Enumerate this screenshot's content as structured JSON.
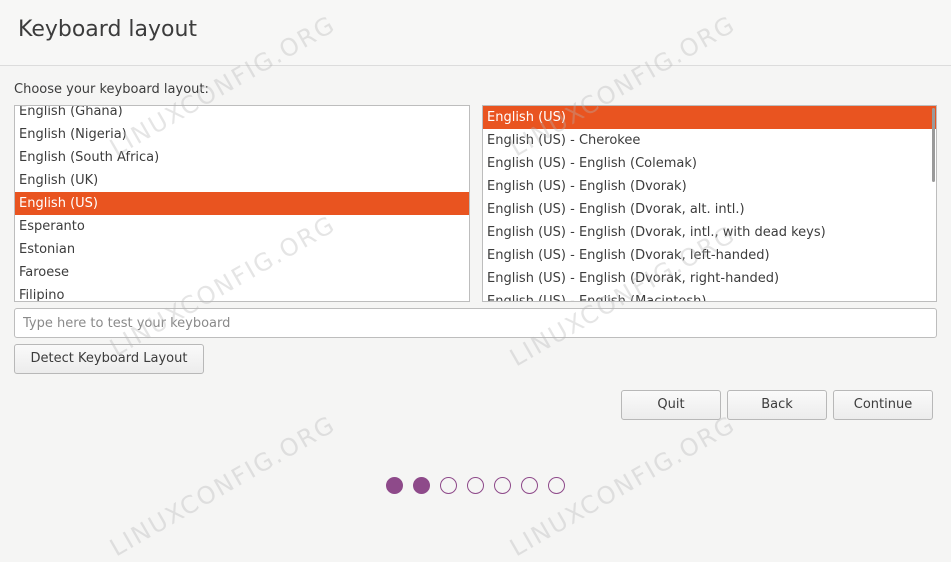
{
  "page": {
    "title": "Keyboard layout",
    "prompt": "Choose your keyboard layout:"
  },
  "layouts": {
    "items": [
      "English (Ghana)",
      "English (Nigeria)",
      "English (South Africa)",
      "English (UK)",
      "English (US)",
      "Esperanto",
      "Estonian",
      "Faroese",
      "Filipino"
    ],
    "selected": "English (US)"
  },
  "variants": {
    "items": [
      "English (US)",
      "English (US) - Cherokee",
      "English (US) - English (Colemak)",
      "English (US) - English (Dvorak)",
      "English (US) - English (Dvorak, alt. intl.)",
      "English (US) - English (Dvorak, intl., with dead keys)",
      "English (US) - English (Dvorak, left-handed)",
      "English (US) - English (Dvorak, right-handed)",
      "English (US) - English (Macintosh)"
    ],
    "selected": "English (US)"
  },
  "test_input": {
    "placeholder": "Type here to test your keyboard",
    "value": ""
  },
  "buttons": {
    "detect": "Detect Keyboard Layout",
    "quit": "Quit",
    "back": "Back",
    "continue": "Continue"
  },
  "progress": {
    "total_steps": 7,
    "current_step": 2
  },
  "watermark": "LINUXCONFIG.ORG",
  "colors": {
    "accent": "#e95420",
    "progress_dot": "#8e4a8a"
  }
}
